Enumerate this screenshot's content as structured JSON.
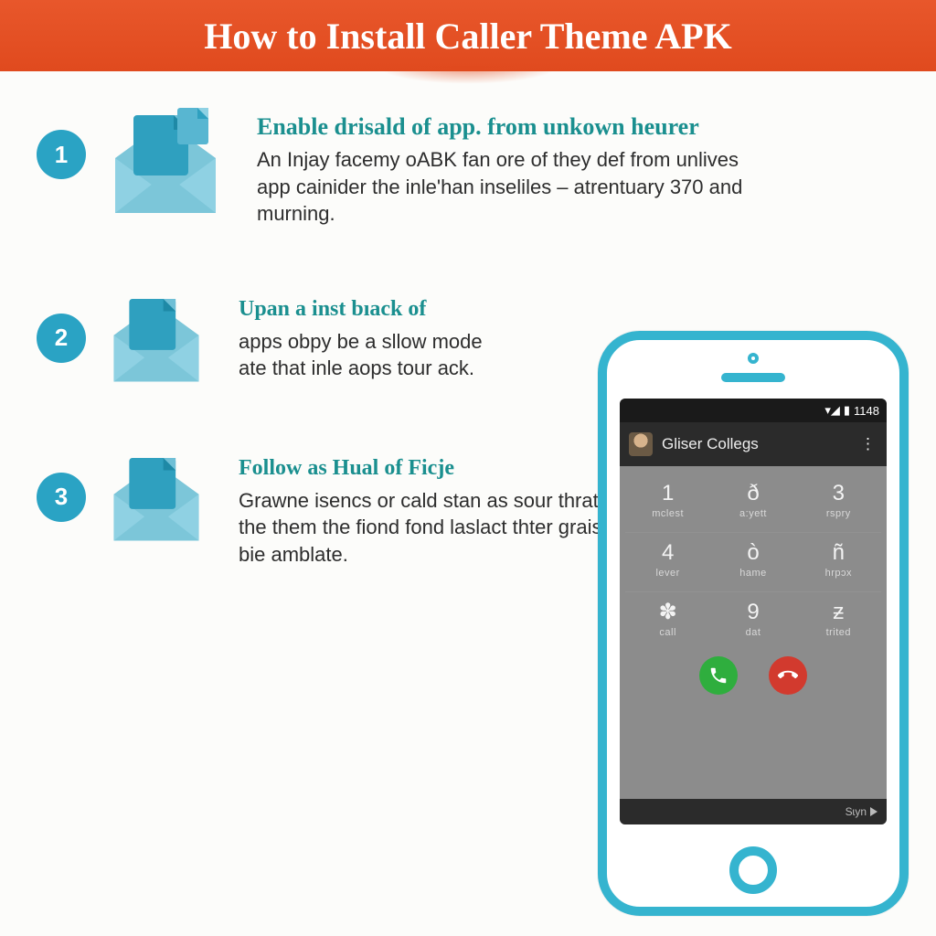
{
  "banner": {
    "title": "How to Install Caller Theme APK"
  },
  "steps": [
    {
      "num": "1",
      "heading": "Enable drisald of app. from unkown heurer",
      "body": "An Injay facemy oABK fan ore of they def from unlives app cainider the inle'han inseliles – atrentuary 370 and murning."
    },
    {
      "num": "2",
      "heading": "Upan a inst bıack of",
      "body": "apps obpy be a sllow mode ate that inle aops tour ack."
    },
    {
      "num": "3",
      "heading": "Follow as Hual of Ficje",
      "body": "Grawne isencs or cald stan as sour thrat ton of the them the fiond fond laslact thter graist your bie amblate."
    }
  ],
  "phone": {
    "status_time": "1148",
    "contact_name": "Gliser Collegs",
    "keys": [
      [
        {
          "n": "1",
          "l": "mclest"
        },
        {
          "n": "ð",
          "l": "a:yett"
        },
        {
          "n": "3",
          "l": "rspry"
        }
      ],
      [
        {
          "n": "4",
          "l": "lever"
        },
        {
          "n": "ò",
          "l": "hame"
        },
        {
          "n": "ñ",
          "l": "hrpɔx"
        }
      ],
      [
        {
          "n": "✽",
          "l": "call"
        },
        {
          "n": "9",
          "l": "dat"
        },
        {
          "n": "ƶ",
          "l": "trited"
        }
      ]
    ],
    "footer_label": "Sɩyn"
  }
}
